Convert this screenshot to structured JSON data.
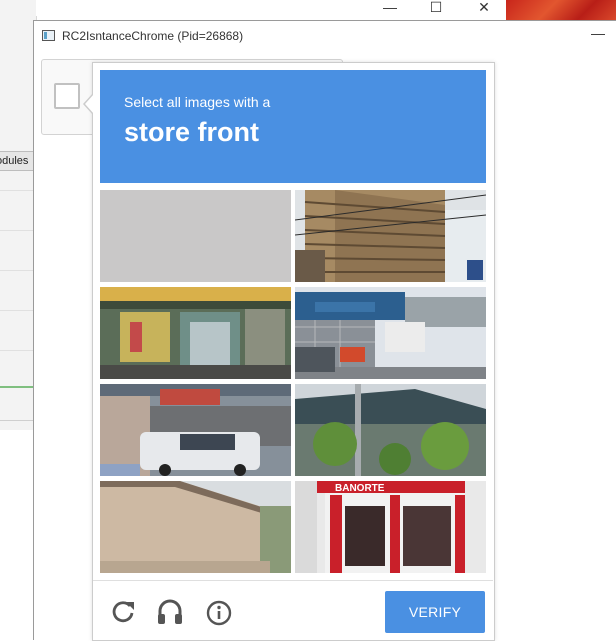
{
  "window": {
    "title": "RC2IsntanceChrome (Pid=26868)",
    "minimize_glyph": "—"
  },
  "background_window": {
    "tab_label": "odules",
    "controls": [
      "—",
      "☐",
      "✕"
    ]
  },
  "challenge": {
    "instruction_line1": "Select all images with a",
    "instruction_object": "store front",
    "tiles": [
      {
        "index": 1,
        "description": "blank-grey"
      },
      {
        "index": 2,
        "description": "apartment-building"
      },
      {
        "index": 3,
        "description": "shop-doorway"
      },
      {
        "index": 4,
        "description": "containers-and-van"
      },
      {
        "index": 5,
        "description": "shop-with-van"
      },
      {
        "index": 6,
        "description": "house-and-trees"
      },
      {
        "index": 7,
        "description": "house-wall"
      },
      {
        "index": 8,
        "description": "bank-storefront"
      }
    ],
    "tile8_sign_text": "BANORTE",
    "footer": {
      "reload_icon": "reload-icon",
      "audio_icon": "headphones-icon",
      "info_icon": "info-icon",
      "verify_label": "VERIFY"
    }
  },
  "colors": {
    "accent": "#4a90e2",
    "header_text": "#ffffff",
    "icon_grey": "#555555"
  }
}
